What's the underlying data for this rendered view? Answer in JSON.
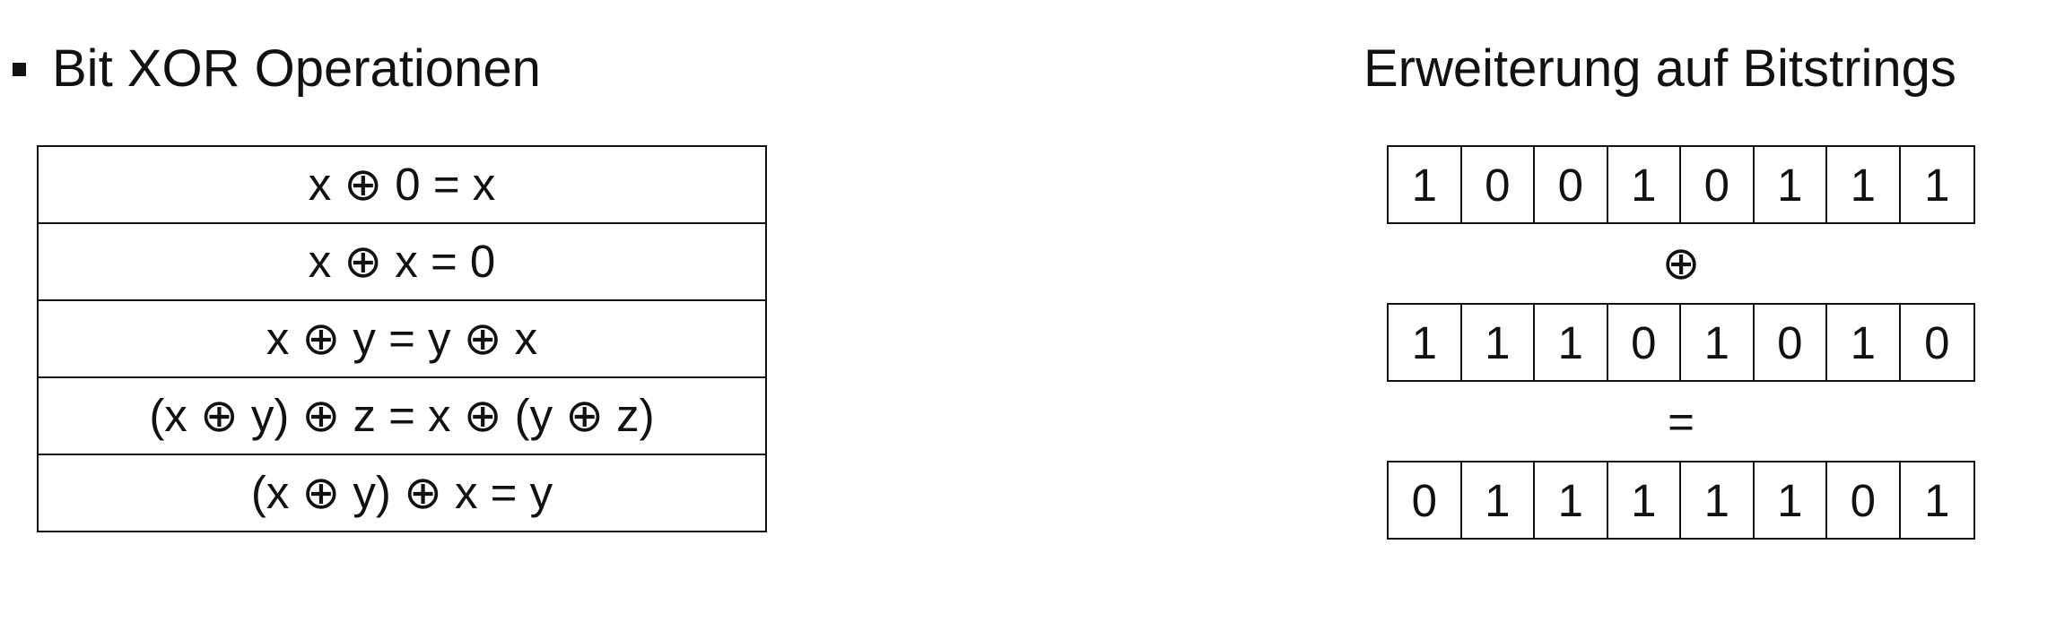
{
  "left_section": {
    "heading": "Bit XOR Operationen",
    "rules": [
      "x ⊕ 0 = x",
      "x ⊕ x = 0",
      "x ⊕ y = y ⊕ x",
      "(x ⊕ y) ⊕ z = x ⊕ (y ⊕ z)",
      "(x ⊕ y) ⊕ x = y"
    ]
  },
  "right_section": {
    "heading": "Erweiterung auf Bitstrings",
    "operand_a": [
      "1",
      "0",
      "0",
      "1",
      "0",
      "1",
      "1",
      "1"
    ],
    "operator_symbol": "⊕",
    "operand_b": [
      "1",
      "1",
      "1",
      "0",
      "1",
      "0",
      "1",
      "0"
    ],
    "equals_symbol": "=",
    "result": [
      "0",
      "1",
      "1",
      "1",
      "1",
      "1",
      "0",
      "1"
    ]
  }
}
